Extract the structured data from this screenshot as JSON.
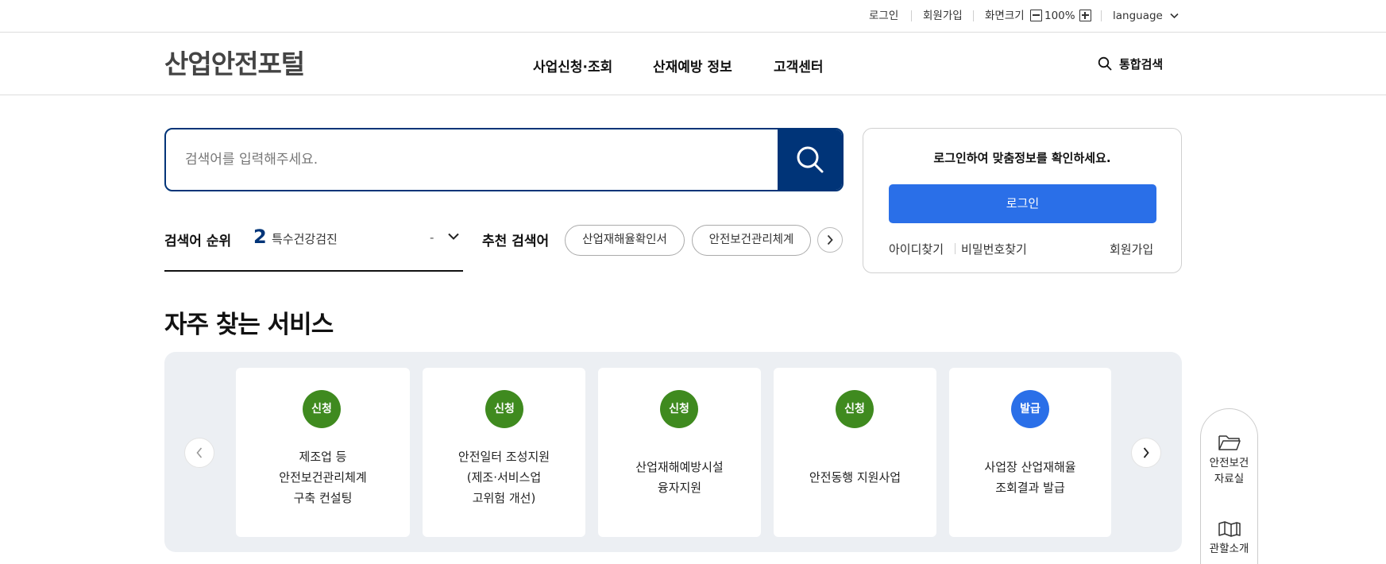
{
  "util_bar": {
    "login": "로그인",
    "signup": "회원가입",
    "zoom_label": "화면크기",
    "zoom_value": "100%",
    "language": "language"
  },
  "header": {
    "logo": "산업안전포털",
    "nav": [
      "사업신청·조회",
      "산재예방 정보",
      "고객센터"
    ],
    "search_link": "통합검색"
  },
  "search": {
    "placeholder": "검색어를 입력해주세요."
  },
  "ranking": {
    "label": "검색어 순위",
    "number": "2",
    "term": "특수건강검진",
    "change": "-"
  },
  "recommend": {
    "label": "추천 검색어",
    "chips": [
      "산업재해율확인서",
      "안전보건관리체계"
    ]
  },
  "login_card": {
    "message": "로그인하여 맞춤정보를 확인하세요.",
    "login_button": "로그인",
    "find_id": "아이디찾기",
    "find_password": "비밀번호찾기",
    "signup": "회원가입"
  },
  "services": {
    "title": "자주 찾는 서비스",
    "cards": [
      {
        "badge": "신청",
        "badge_color": "#3f8a1f",
        "lines": [
          "제조업 등",
          "안전보건관리체계",
          "구축 컨설팅"
        ]
      },
      {
        "badge": "신청",
        "badge_color": "#3f8a1f",
        "lines": [
          "안전일터 조성지원",
          "(제조·서비스업",
          "고위험 개선)"
        ]
      },
      {
        "badge": "신청",
        "badge_color": "#3f8a1f",
        "lines": [
          "산업재해예방시설",
          "융자지원"
        ]
      },
      {
        "badge": "신청",
        "badge_color": "#3f8a1f",
        "lines": [
          "안전동행 지원사업"
        ]
      },
      {
        "badge": "발급",
        "badge_color": "#2a6fe8",
        "lines": [
          "사업장 산업재해율",
          "조회결과 발급"
        ]
      }
    ]
  },
  "quick_menu": {
    "items": [
      {
        "icon": "folder-icon",
        "lines": [
          "안전보건",
          "자료실"
        ]
      },
      {
        "icon": "map-icon",
        "lines": [
          "관할소개"
        ]
      }
    ]
  },
  "colors": {
    "primary_navy": "#003478",
    "primary_blue": "#2a6fe8",
    "apply_green": "#3f8a1f"
  }
}
